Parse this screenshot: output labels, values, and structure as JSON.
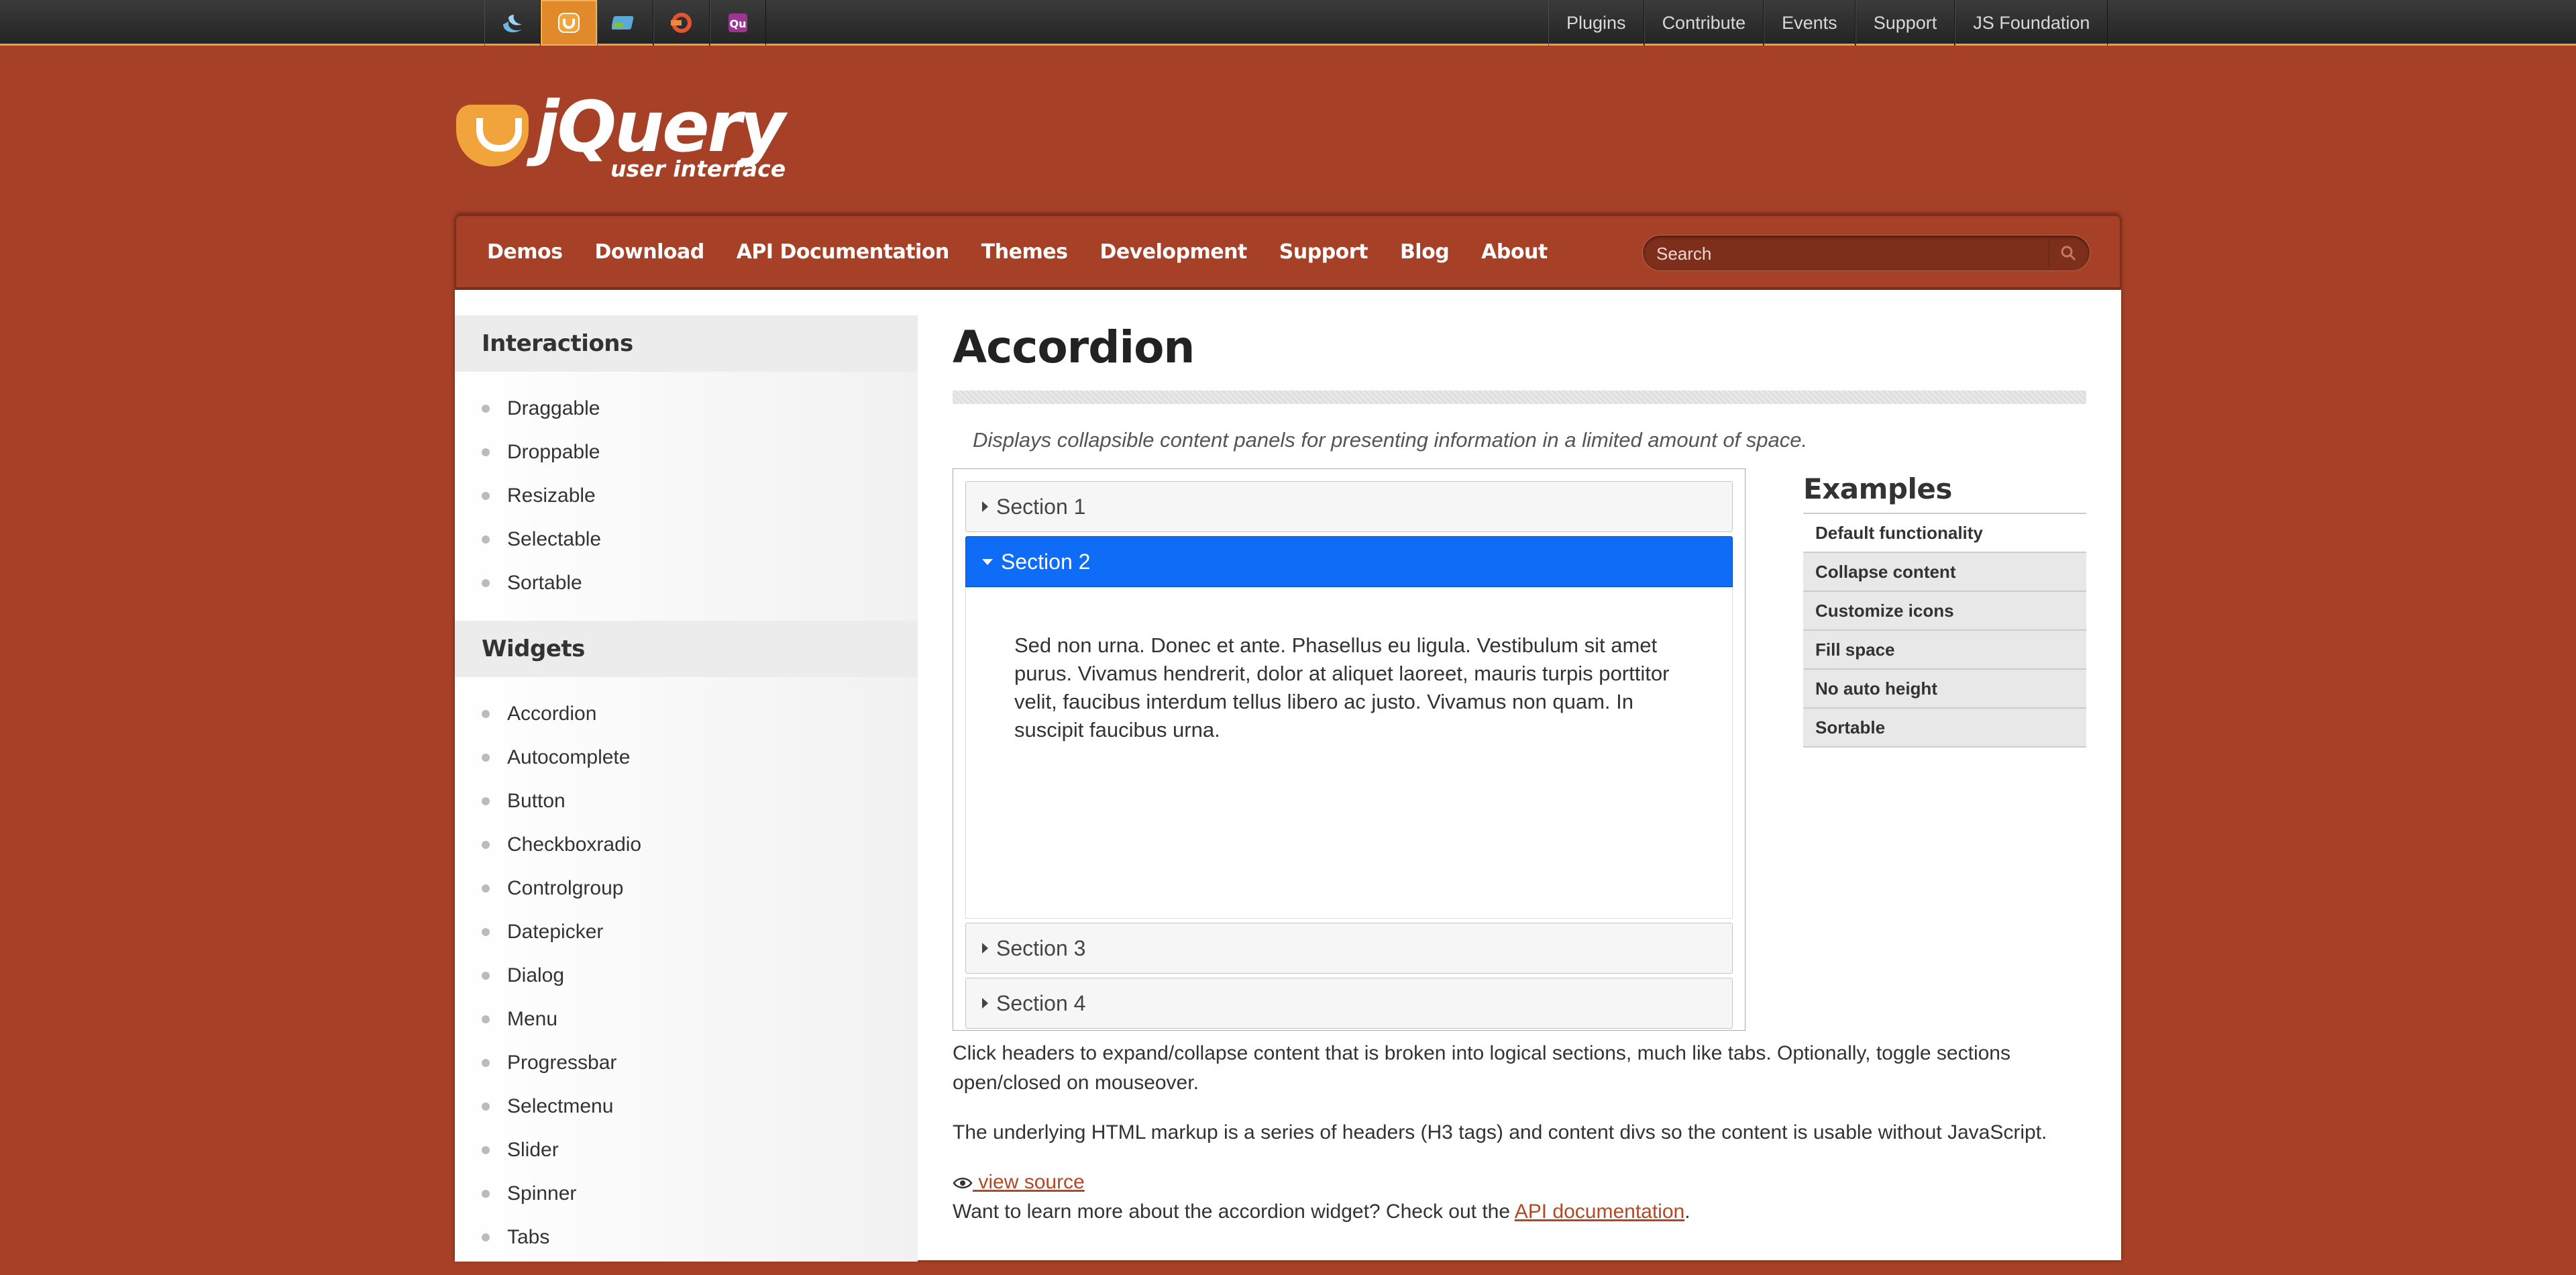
{
  "topbar": {
    "project_tabs": [
      {
        "name": "jquery",
        "icon": "jquery-icon",
        "color": "#6fb6e8"
      },
      {
        "name": "jquery-ui",
        "icon": "jquery-ui-icon",
        "color": "#f1a43b",
        "active": true
      },
      {
        "name": "jquery-mobile",
        "icon": "jquery-mobile-icon",
        "color": "#5aa9d6"
      },
      {
        "name": "sizzle",
        "icon": "sizzle-icon",
        "color": "#e2552d"
      },
      {
        "name": "qunit",
        "icon": "qunit-icon",
        "color": "#9c3493"
      }
    ],
    "sites": [
      "Plugins",
      "Contribute",
      "Events",
      "Support",
      "JS Foundation"
    ]
  },
  "logo": {
    "word": "jQuery",
    "sub": "user interface"
  },
  "nav": {
    "items": [
      "Demos",
      "Download",
      "API Documentation",
      "Themes",
      "Development",
      "Support",
      "Blog",
      "About"
    ],
    "search_placeholder": "Search"
  },
  "sidebar": {
    "sections": [
      {
        "title": "Interactions",
        "items": [
          "Draggable",
          "Droppable",
          "Resizable",
          "Selectable",
          "Sortable"
        ]
      },
      {
        "title": "Widgets",
        "items": [
          "Accordion",
          "Autocomplete",
          "Button",
          "Checkboxradio",
          "Controlgroup",
          "Datepicker",
          "Dialog",
          "Menu",
          "Progressbar",
          "Selectmenu",
          "Slider",
          "Spinner",
          "Tabs"
        ]
      }
    ]
  },
  "content": {
    "title": "Accordion",
    "description": "Displays collapsible content panels for presenting information in a limited amount of space.",
    "accordion": {
      "sections": [
        "Section 1",
        "Section 2",
        "Section 3",
        "Section 4"
      ],
      "active_index": 1,
      "active_color": "#0f6cf6",
      "panel_text": "Sed non urna. Donec et ante. Phasellus eu ligula. Vestibulum sit amet purus. Vivamus hendrerit, dolor at aliquet laoreet, mauris turpis porttitor velit, faucibus interdum tellus libero ac justo. Vivamus non quam. In suscipit faucibus urna."
    },
    "examples": {
      "title": "Examples",
      "items": [
        "Default functionality",
        "Collapse content",
        "Customize icons",
        "Fill space",
        "No auto height",
        "Sortable"
      ]
    },
    "para1": "Click headers to expand/collapse content that is broken into logical sections, much like tabs. Optionally, toggle sections open/closed on mouseover.",
    "para2": "The underlying HTML markup is a series of headers (H3 tags) and content divs so the content is usable without JavaScript.",
    "view_source": "view source",
    "learn_more_prefix": "Want to learn more about the accordion widget? Check out the ",
    "learn_more_link": "API documentation",
    "learn_more_suffix": "."
  },
  "colors": {
    "brand": "#a64026",
    "accent": "#e8a33d"
  }
}
